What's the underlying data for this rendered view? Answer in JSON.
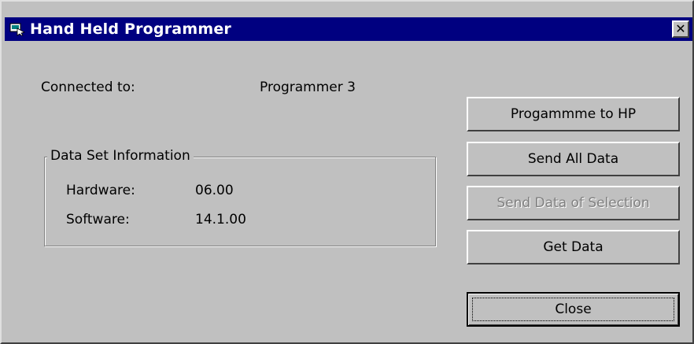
{
  "window": {
    "title": "Hand Held Programmer",
    "close_glyph": "✕"
  },
  "connection": {
    "label": "Connected to:",
    "value": "Programmer 3"
  },
  "data_set": {
    "group_title": "Data Set Information",
    "hardware_label": "Hardware:",
    "hardware_value": "06.00",
    "software_label": "Software:",
    "software_value": "14.1.00"
  },
  "buttons": {
    "programme": "Progammme to HP",
    "send_all": "Send All Data",
    "send_selection": "Send Data of Selection",
    "get_data": "Get Data",
    "close": "Close"
  },
  "icons": {
    "app": "hand-held-programmer-icon"
  },
  "colors": {
    "titlebar": "#000080",
    "face": "#c0c0c0"
  }
}
